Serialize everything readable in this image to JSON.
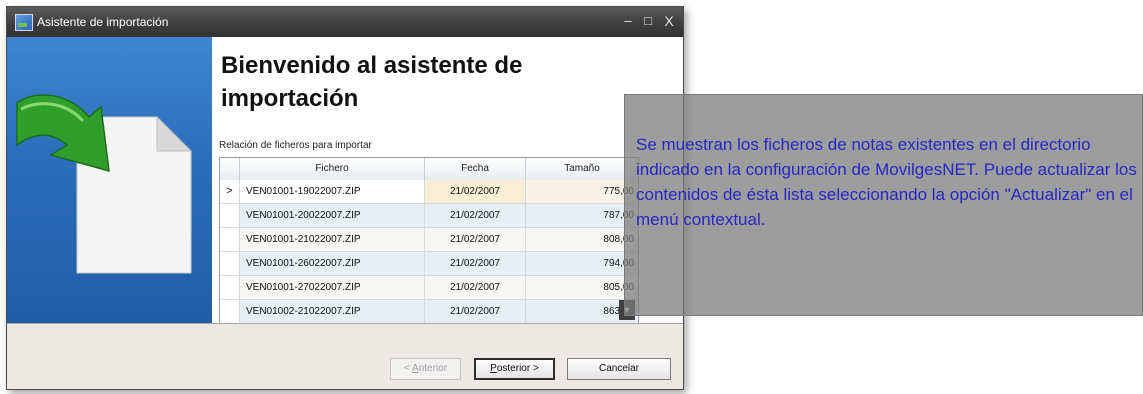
{
  "window": {
    "title": "Asistente de importación",
    "controls": {
      "minimize": "–",
      "maximize": "□",
      "close": "X"
    }
  },
  "content": {
    "heading": "Bienvenido al asistente de importación",
    "grid_caption": "Relación de ficheros para importar",
    "columns": [
      "Fichero",
      "Fecha",
      "Tamaño"
    ],
    "rows": [
      {
        "indicator": ">",
        "file": "VEN01001-19022007.ZIP",
        "date": "21/02/2007",
        "size": "775,00"
      },
      {
        "indicator": "",
        "file": "VEN01001-20022007.ZIP",
        "date": "21/02/2007",
        "size": "787,00"
      },
      {
        "indicator": "",
        "file": "VEN01001-21022007.ZIP",
        "date": "21/02/2007",
        "size": "808,00"
      },
      {
        "indicator": "",
        "file": "VEN01001-26022007.ZIP",
        "date": "21/02/2007",
        "size": "794,00"
      },
      {
        "indicator": "",
        "file": "VEN01001-27022007.ZIP",
        "date": "21/02/2007",
        "size": "805,00"
      },
      {
        "indicator": "",
        "file": "VEN01002-21022007.ZIP",
        "date": "21/02/2007",
        "size": "863,00"
      }
    ],
    "selected_row": 0
  },
  "footer": {
    "back": {
      "prefix": "< ",
      "mnemonic": "A",
      "rest": "nterior",
      "enabled": false
    },
    "next": {
      "mnemonic": "P",
      "rest": "osterior >"
    },
    "cancel": "Cancelar"
  },
  "overlay": {
    "text": "Se muestran los ficheros de notas existentes en el directorio indicado en la configuración de MovilgesNET. Puede actualizar los contenidos de ésta lista seleccionando la opción \"Actualizar\" en el menú contextual."
  },
  "colors": {
    "sidebar": "#2c6fbc",
    "arrow": "#2f9e2a",
    "overlay_text": "#2727c6",
    "titlebar": "#3e3e3e"
  },
  "icons": [
    "app-icon",
    "import-arrow-icon",
    "document-icon",
    "scroll-down-icon"
  ]
}
